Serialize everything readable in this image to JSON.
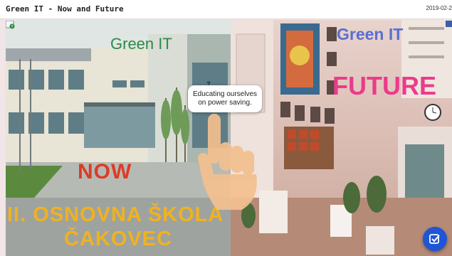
{
  "header": {
    "title": "Green IT - Now and Future",
    "date": "2019-02-2"
  },
  "left_panel": {
    "heading": "Green IT",
    "caption": "NOW",
    "school_line1": "II. OSNOVNA ŠKOLA",
    "school_line2": "ČAKOVEC"
  },
  "right_panel": {
    "heading": "Green IT",
    "caption": "FUTURE"
  },
  "hotspot": {
    "marker": "?",
    "tooltip_line1": "Educating ourselves",
    "tooltip_line2": "on power saving."
  },
  "icons": {
    "help": "help-icon",
    "corner": "expand-icon",
    "hand": "pointing-hand-icon",
    "fab": "checklist-icon"
  },
  "colors": {
    "now_green": "#2d8a45",
    "now_red": "#dd3b27",
    "school_yellow": "#f0b21f",
    "future_blue": "#5a6fcf",
    "future_pink": "#ec3b8a",
    "fab_blue": "#1f55d6"
  }
}
